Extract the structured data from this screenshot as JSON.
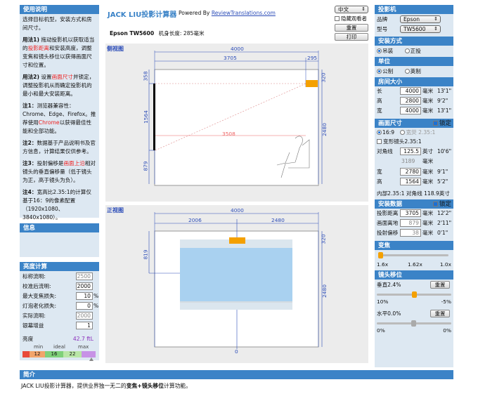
{
  "left": {
    "usage_header": "使用说明",
    "intro": "选择目标机型，安装方式和房间尺寸。",
    "p1_a": "用法1)",
    "p1_b": " 拖动投影机以获取适当的",
    "p1_red": "投影距离",
    "p1_c": "和安装高度，调整变焦和镜头移位以获得画面尺寸和位置。",
    "p2_a": "用法2)",
    "p2_b": " 设置",
    "p2_red": "画面尺寸",
    "p2_c": "并锁定，调整投影机从而确定投影机的最小和最大安装距离。",
    "n1_a": "注1：",
    "n1_b": "测览器兼容性：Chrome、Edge、Firefox。推荐使用",
    "n1_red": "Chrome",
    "n1_c": "以获得最佳性能和全部功能。",
    "n2_a": "注2：",
    "n2_b": "数据基于产品说明书及官方信息，计算结果仅供参考。",
    "n3_a": "注3：",
    "n3_b": "投射偏移是",
    "n3_red": "画面上沿",
    "n3_c": "相对镜头的垂直偏移量（低于镜头为正，高于镜头为负）。",
    "n4_a": "注4：",
    "n4_b": "宽高比2.35:1的计算仅基于16：9的像素配置（1920x1080、3840x1080）。",
    "info_header": "信息",
    "bright_header": "亮度计算",
    "bright_rows": [
      {
        "label": "标称流明:",
        "value": "2500",
        "unit": "",
        "gray": true
      },
      {
        "label": "校准后流明:",
        "value": "2000",
        "unit": "",
        "gray": false
      },
      {
        "label": "最大变焦损失:",
        "value": "10",
        "unit": "%",
        "gray": false
      },
      {
        "label": "灯泡老化损失:",
        "value": "0",
        "unit": "%",
        "gray": false
      },
      {
        "label": "实际流明:",
        "value": "2000",
        "unit": "",
        "gray": true
      },
      {
        "label": "银幕增益",
        "value": "1",
        "unit": "",
        "gray": false
      }
    ],
    "brightness_label": "亮度",
    "brightness_value": "42.7 ftL",
    "bar_labels": [
      "min",
      "ideal",
      "max"
    ],
    "bar_values": [
      "12",
      "16",
      "22"
    ]
  },
  "center": {
    "title": "JACK LIU投影计算器",
    "powered": "Powered By",
    "powered_link": "ReviewTranslations.com",
    "lang": "中文",
    "hide_viewer": "隐藏观看者",
    "reset": "重置",
    "print": "打印",
    "model_line": "Epson TW5600",
    "body_length": "机身长度: 285毫米",
    "side_title": "侧视图",
    "front_title": "正视图",
    "side_dims": {
      "total": "4000",
      "a": "3705",
      "b": "295",
      "top": "358",
      "mid": "1564",
      "bot": "879",
      "right_top": "320",
      "right": "2480",
      "throw": "3508"
    },
    "front_dims": {
      "total": "4000",
      "left": "2006",
      "right": "2480",
      "left_v": "819",
      "right_top": "320",
      "zero": "0"
    }
  },
  "right": {
    "projector_header": "投影机",
    "brand_label": "品牌",
    "brand": "Epson",
    "model_label": "型号",
    "model": "TW5600",
    "install_header": "安装方式",
    "ceiling": "吊装",
    "floor": "正投",
    "unit_header": "单位",
    "metric": "公制",
    "imperial": "英制",
    "room_header": "房间大小",
    "room_rows": [
      {
        "label": "长",
        "value": "4000",
        "unit": "毫米",
        "imp": "13'1\""
      },
      {
        "label": "高",
        "value": "2800",
        "unit": "毫米",
        "imp": "9'2\""
      },
      {
        "label": "宽",
        "value": "4000",
        "unit": "毫米",
        "imp": "13'1\""
      }
    ],
    "screen_header": "画面尺寸",
    "lock": "锁定",
    "ratio_169": "16:9",
    "ratio_235": "宽荧 2.35:1",
    "anamorphic": "变形镜头2.35:1",
    "diag_label": "对角线",
    "diag_value": "125.5",
    "diag_unit": "英寸",
    "diag_imp": "10'6\"",
    "diag_mm": "3189",
    "diag_mm_unit": "毫米",
    "screen_rows": [
      {
        "label": "宽",
        "value": "2780",
        "unit": "毫米",
        "imp": "9'1\""
      },
      {
        "label": "高",
        "value": "1564",
        "unit": "毫米",
        "imp": "5'2\""
      }
    ],
    "inner_235": "内部2.35:1 对角线",
    "inner_235_value": "118.9英寸",
    "install_data_header": "安装数据",
    "install_rows": [
      {
        "label": "投影距离",
        "value": "3705",
        "unit": "毫米",
        "imp": "12'2\"",
        "gray": false
      },
      {
        "label": "画面离地",
        "value": "879",
        "unit": "毫米",
        "imp": "2'11\"",
        "gray": true
      },
      {
        "label": "投射偏移",
        "value": "38",
        "unit": "毫米",
        "imp": "0'1\"",
        "gray": true
      }
    ],
    "zoom_header": "变焦",
    "zoom_labels": [
      "1.6x",
      "1.62x",
      "1.0x"
    ],
    "shift_header": "镜头移位",
    "vshift": "垂直2.4%",
    "vshift_range": [
      "10%",
      "-5%"
    ],
    "hshift": "水平0.0%",
    "hshift_range": [
      "0%",
      "0%"
    ],
    "reset": "重置"
  },
  "bottom": {
    "header": "简介",
    "text_a": "JACK LIU投影计算器，提供业界独一无二的",
    "text_b": "变焦+镜头移位",
    "text_c": "计算功能。"
  },
  "colors": {
    "header": "#3b83c7",
    "panel": "#dde8f2",
    "accent": "#f4a000",
    "screen": "#a9d1f0",
    "dim": "#2b4cb8"
  }
}
